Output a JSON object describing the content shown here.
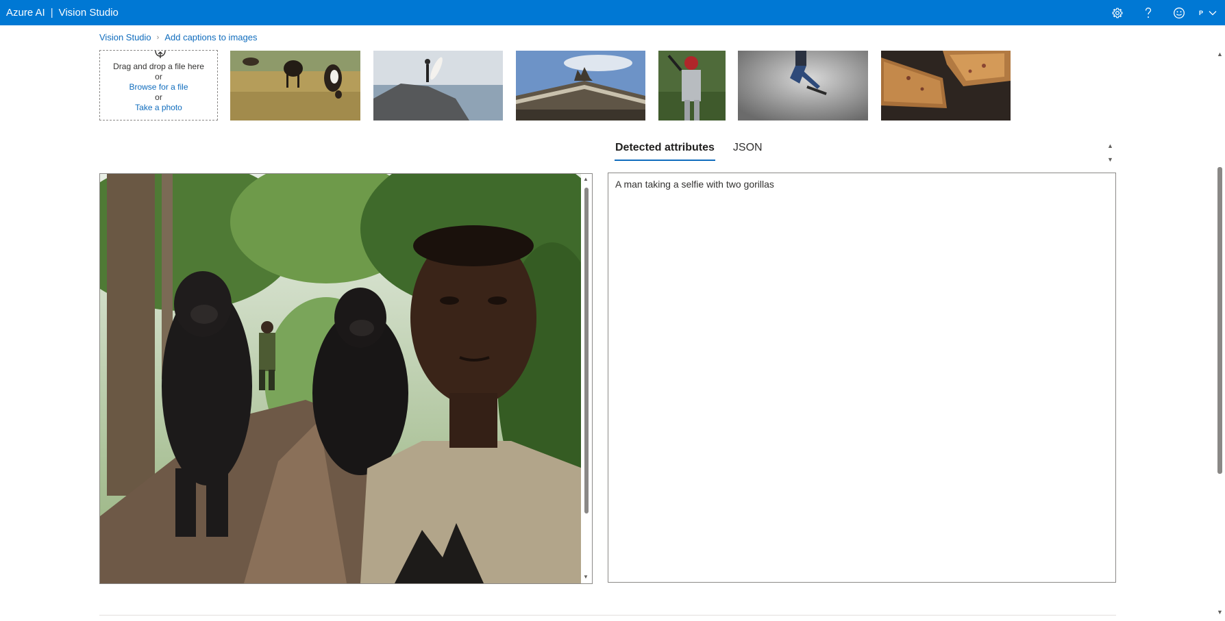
{
  "header": {
    "brand_left": "Azure AI",
    "brand_sep": "|",
    "brand_right": "Vision Studio",
    "icons": [
      "gear-icon",
      "help-icon",
      "smiley-feedback-icon"
    ],
    "avatar_initial": "P"
  },
  "breadcrumb": {
    "items": [
      "Vision Studio",
      "Add captions to images"
    ]
  },
  "upload": {
    "line1": "Drag and drop a file here",
    "or1": "or",
    "browse": "Browse for a file",
    "or2": "or",
    "photo": "Take a photo"
  },
  "thumbnails": [
    "cows-grazing",
    "surfer-on-rock",
    "building-statues",
    "baseball-batter",
    "skateboarder",
    "grilled-sandwiches"
  ],
  "tabs": {
    "detected": "Detected attributes",
    "json": "JSON"
  },
  "result": {
    "caption": "A man taking a selfie with two gorillas"
  },
  "colors": {
    "header_bg": "#0078d4",
    "link": "#0f6cbd",
    "border": "#8a8886"
  }
}
